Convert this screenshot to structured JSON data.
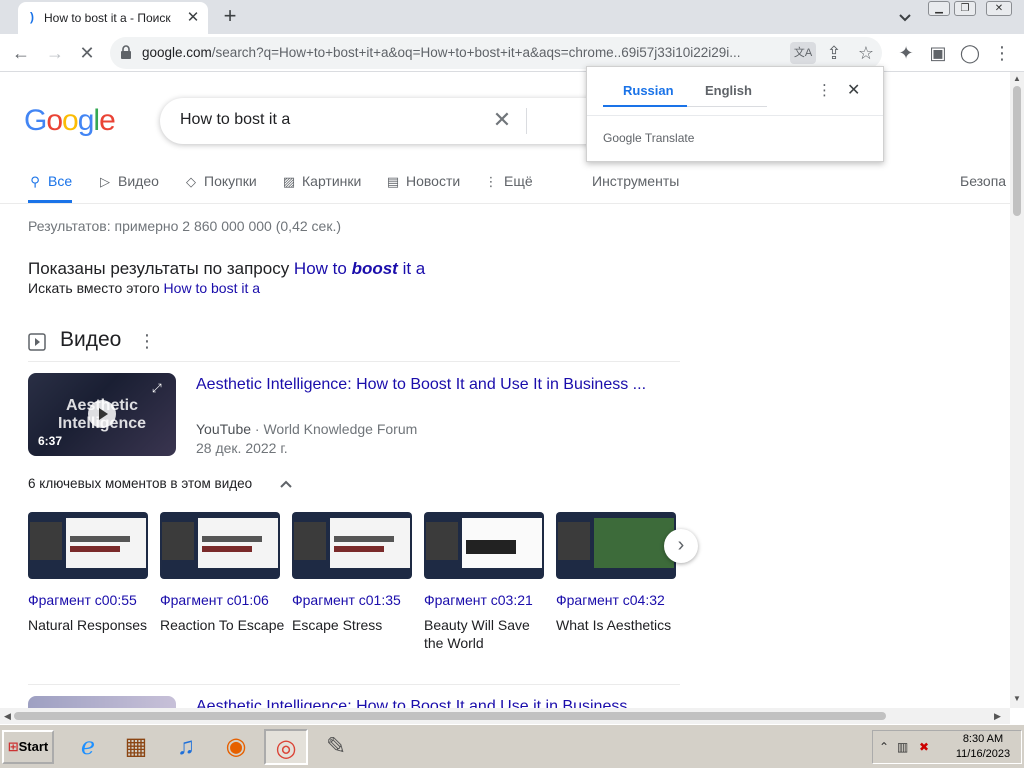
{
  "tab": {
    "title": "How to bost it a - Поиск",
    "favicon": "google-favicon"
  },
  "browser": {
    "url_main": "google.com",
    "url_rest": "/search?q=How+to+bost+it+a&oq=How+to+bost+it+a&aqs=chrome..69i57j33i10i22i29i..."
  },
  "search": {
    "query": "How to bost it a"
  },
  "logo": {
    "text": "Google",
    "colors": [
      "#4285F4",
      "#EA4335",
      "#FBBC05",
      "#4285F4",
      "#34A853",
      "#EA4335"
    ]
  },
  "nav": {
    "tabs": [
      {
        "label": "Все",
        "icon": "search-icon",
        "active": true
      },
      {
        "label": "Видео",
        "icon": "play-icon"
      },
      {
        "label": "Покупки",
        "icon": "tag-icon"
      },
      {
        "label": "Картинки",
        "icon": "image-icon"
      },
      {
        "label": "Новости",
        "icon": "news-icon"
      },
      {
        "label": "Ещё",
        "icon": "more-icon"
      }
    ],
    "tools": "Инструменты",
    "safe": "Безопа"
  },
  "stats": "Результатов: примерно 2 860 000 000 (0,42 сек.)",
  "spell": {
    "shown_prefix": "Показаны результаты по запросу ",
    "shown_a": "How to ",
    "shown_b": "boost",
    "shown_c": " it a",
    "instead_prefix": "Искать вместо этого ",
    "instead_query": "How to bost it a"
  },
  "videos": {
    "heading": "Видео",
    "items": [
      {
        "title": "Aesthetic Intelligence: How to Boost It and Use It in Business ...",
        "source": "YouTube",
        "channel": "World Knowledge Forum",
        "date": "28 дек. 2022 г.",
        "duration": "6:37",
        "thumb_text": "Aesthetic Intelligence"
      }
    ],
    "moments_heading": "6 ключевых моментов в этом видео",
    "moments": [
      {
        "time": "Фрагмент с00:55",
        "label": "Natural Responses"
      },
      {
        "time": "Фрагмент с01:06",
        "label": "Reaction To Escape"
      },
      {
        "time": "Фрагмент с01:35",
        "label": "Escape Stress"
      },
      {
        "time": "Фрагмент с03:21",
        "label": "Beauty Will Save the World"
      },
      {
        "time": "Фрагмент с04:32",
        "label": "What Is Aesthetics"
      }
    ],
    "next_title": "Aesthetic Intelligence: How to Boost It and Use it in Business"
  },
  "translate": {
    "lang_from": "Russian",
    "lang_to": "English",
    "brand": "Google Translate"
  },
  "taskbar": {
    "start": "Start",
    "time": "8:30 AM",
    "date": "11/16/2023"
  }
}
